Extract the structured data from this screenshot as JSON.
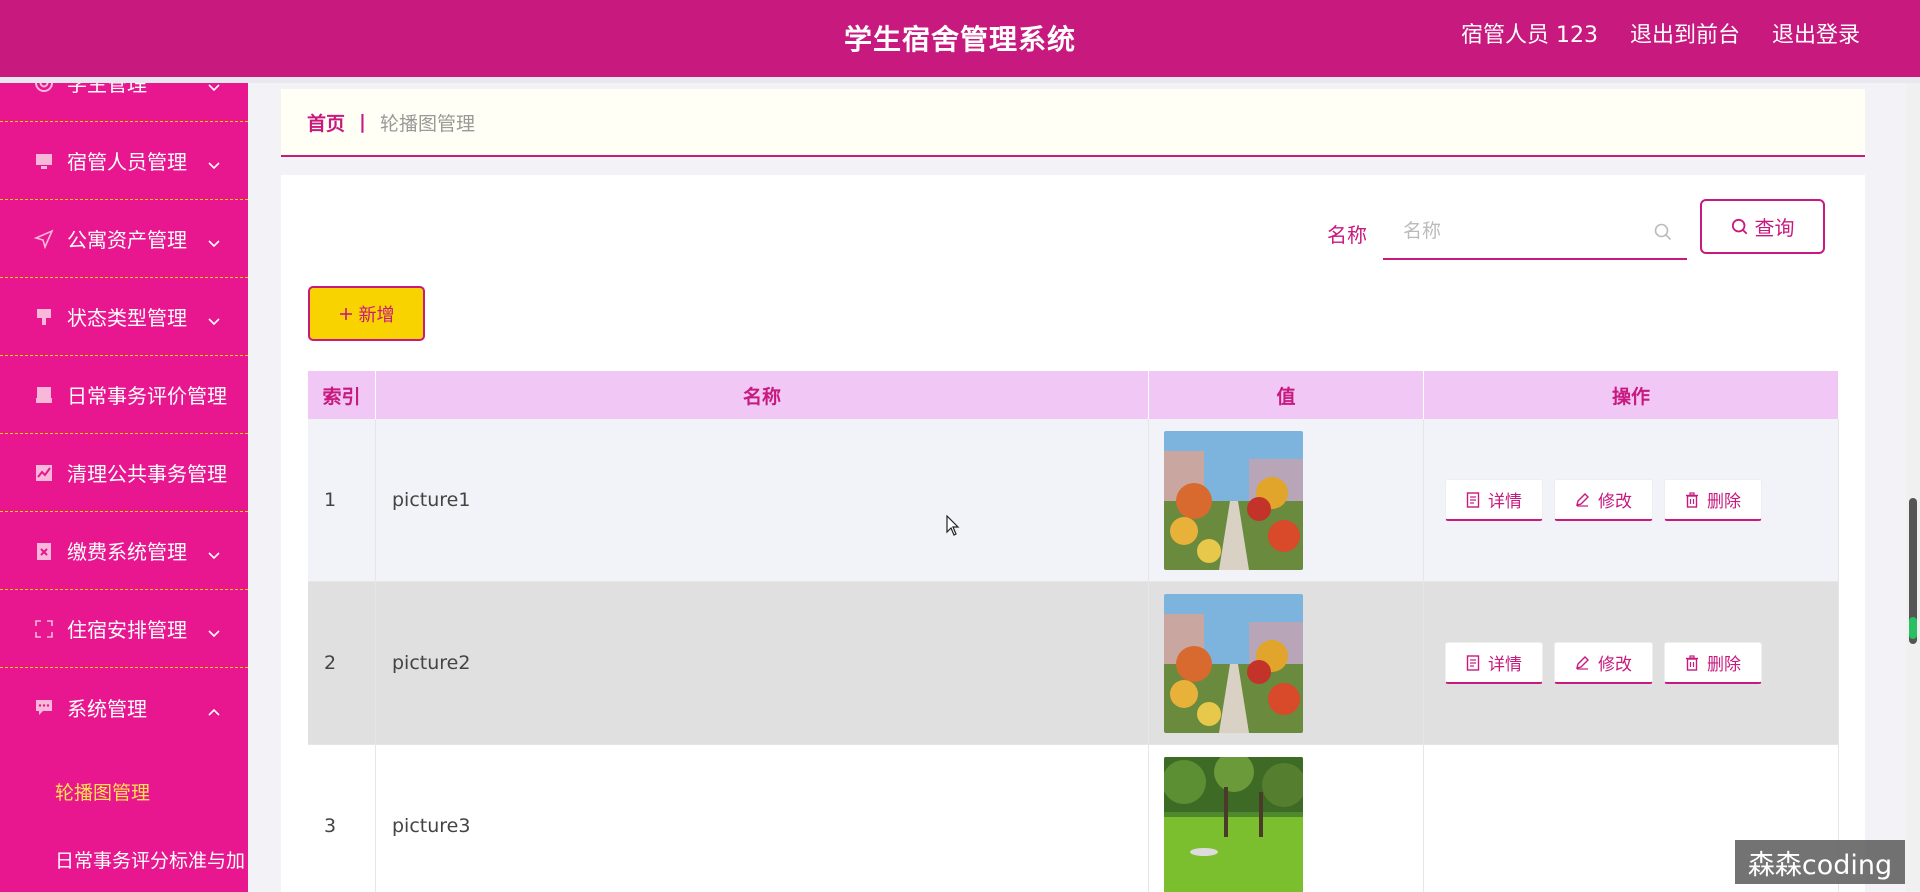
{
  "header": {
    "title": "学生宿舍管理系统",
    "user": "宿管人员 123",
    "back_to_front": "退出到前台",
    "logout": "退出登录"
  },
  "sidebar": {
    "items": [
      {
        "label": "学生管理",
        "icon": "target-icon",
        "arrow": "down"
      },
      {
        "label": "宿管人员管理",
        "icon": "monitor-icon",
        "arrow": "down"
      },
      {
        "label": "公寓资产管理",
        "icon": "send-icon",
        "arrow": "down"
      },
      {
        "label": "状态类型管理",
        "icon": "brush-icon",
        "arrow": "down"
      },
      {
        "label": "日常事务评价管理",
        "icon": "printer-icon",
        "arrow": "none"
      },
      {
        "label": "清理公共事务管理",
        "icon": "chart-icon",
        "arrow": "none"
      },
      {
        "label": "缴费系统管理",
        "icon": "clipboard-x-icon",
        "arrow": "down"
      },
      {
        "label": "住宿安排管理",
        "icon": "fullscreen-icon",
        "arrow": "down"
      },
      {
        "label": "系统管理",
        "icon": "chat-icon",
        "arrow": "up"
      }
    ],
    "sub_items": [
      {
        "label": "轮播图管理",
        "active": true
      },
      {
        "label": "日常事务评分标准与加",
        "active": false
      }
    ]
  },
  "breadcrumb": {
    "home": "首页",
    "separator": "|",
    "current": "轮播图管理"
  },
  "search": {
    "label": "名称",
    "placeholder": "名称",
    "value": "",
    "button": "查询"
  },
  "add_button": "新增",
  "table": {
    "columns": [
      "索引",
      "名称",
      "值",
      "操作"
    ],
    "rows": [
      {
        "index": "1",
        "name": "picture1",
        "value": "campus-autumn-image"
      },
      {
        "index": "2",
        "name": "picture2",
        "value": "campus-autumn-image"
      },
      {
        "index": "3",
        "name": "picture3",
        "value": "campus-lawn-image"
      }
    ],
    "actions": {
      "detail": "详情",
      "edit": "修改",
      "delete": "删除"
    }
  },
  "watermark": "森森coding",
  "colors": {
    "primary": "#c8197f",
    "sidebar": "#e8168f",
    "accent_yellow": "#f9d300",
    "active_menu": "#ffe44d",
    "table_header": "#f1c8f5"
  }
}
